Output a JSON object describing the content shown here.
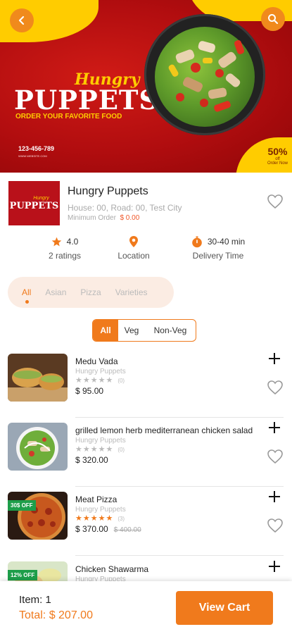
{
  "colors": {
    "accent": "#f07a1c",
    "banner_red": "#b10d0f",
    "banner_yellow": "#ffcc00",
    "discount_green": "#1e9e4a"
  },
  "banner": {
    "brand_script": "Hungry",
    "brand_big": "PUPPETS",
    "tagline": "ORDER YOUR FAVORITE FOOD",
    "phone": "123-456-789",
    "website": "WWW.WEBSITE.COM",
    "offer_pct": "50%",
    "offer_sub": "off",
    "offer_note": "Order Now",
    "back_icon": "chevron-left-icon",
    "search_icon": "search-icon"
  },
  "restaurant": {
    "logo_script": "Hungry",
    "logo_text": "PUPPETS",
    "name": "Hungry Puppets",
    "address": "House: 00, Road: 00, Test City",
    "min_order_label": "Minimum Order",
    "min_order_value": "$ 0.00",
    "rating": "4.0",
    "ratings_count": "2 ratings",
    "location_label": "Location",
    "delivery_time": "30-40 min",
    "delivery_label": "Delivery Time"
  },
  "categories": [
    {
      "label": "All",
      "active": true
    },
    {
      "label": "Asian",
      "active": false
    },
    {
      "label": "Pizza",
      "active": false
    },
    {
      "label": "Varieties",
      "active": false
    }
  ],
  "diet_filter": [
    {
      "label": "All",
      "active": true
    },
    {
      "label": "Veg",
      "active": false
    },
    {
      "label": "Non-Veg",
      "active": false
    }
  ],
  "items": [
    {
      "name": "Medu Vada",
      "restaurant": "Hungry Puppets",
      "stars": 0,
      "reviews": "(0)",
      "price": "$ 95.00",
      "old_price": "",
      "discount": ""
    },
    {
      "name": "grilled lemon herb mediterranean chicken salad",
      "restaurant": "Hungry Puppets",
      "stars": 0,
      "reviews": "(0)",
      "price": "$ 320.00",
      "old_price": "",
      "discount": ""
    },
    {
      "name": "Meat Pizza",
      "restaurant": "Hungry Puppets",
      "stars": 5,
      "reviews": "(3)",
      "price": "$ 370.00",
      "old_price": "$ 400.00",
      "discount": "30$ OFF"
    },
    {
      "name": "Chicken Shawarma",
      "restaurant": "Hungry Puppets",
      "stars": 0,
      "reviews": "",
      "price": "",
      "old_price": "",
      "discount": "12% OFF"
    }
  ],
  "cart": {
    "count": "Item: 1",
    "total": "Total: $ 207.00",
    "button": "View Cart"
  }
}
